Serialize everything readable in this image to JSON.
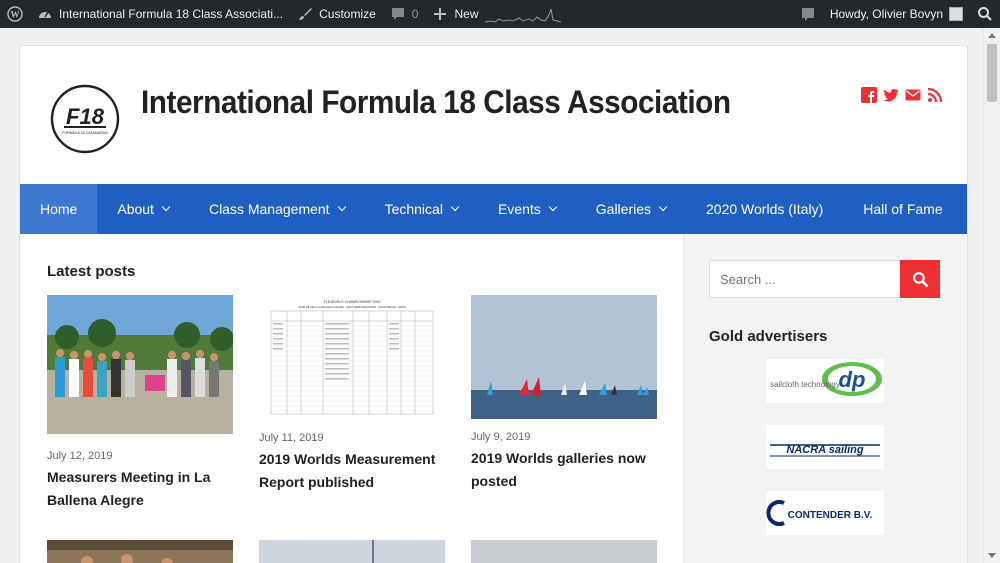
{
  "adminbar": {
    "site_name": "International Formula 18 Class Associati...",
    "customize_label": "Customize",
    "comments_count": "0",
    "new_label": "New",
    "greeting": "Howdy, Olivier Bovyn"
  },
  "site": {
    "title": "International Formula 18 Class Association",
    "logo_text": "F18",
    "logo_subtext": "FORMULA 18 CATAMARAN"
  },
  "social": [
    "facebook-icon",
    "twitter-icon",
    "email-icon",
    "rss-icon"
  ],
  "nav": [
    {
      "label": "Home",
      "active": true,
      "dropdown": false
    },
    {
      "label": "About",
      "dropdown": true
    },
    {
      "label": "Class Management",
      "dropdown": true
    },
    {
      "label": "Technical",
      "dropdown": true
    },
    {
      "label": "Events",
      "dropdown": true
    },
    {
      "label": "Galleries",
      "dropdown": true
    },
    {
      "label": "2020 Worlds (Italy)",
      "dropdown": false
    },
    {
      "label": "Hall of Fame",
      "dropdown": false
    }
  ],
  "main": {
    "section_title": "Latest posts",
    "posts": [
      {
        "date": "July 12, 2019",
        "title": "Measurers Meeting in La Ballena Alegre"
      },
      {
        "date": "July 11, 2019",
        "title": "2019 Worlds Measurement Report published"
      },
      {
        "date": "July 9, 2019",
        "title": "2019 Worlds galleries now posted"
      }
    ],
    "doc_heading": "F18 WORLD CHAMPIONSHIP 2019",
    "doc_subheading": "CLUB DE VELA LA BALLENA ALEGRE - SANT PERE PESCADOR - COSTA BRAVA - SPAIN"
  },
  "sidebar": {
    "search_placeholder": "Search ...",
    "gold_title": "Gold advertisers",
    "advertisers": [
      {
        "name": "sailcloth technology",
        "mark": "dp"
      },
      {
        "name": "NACRA sailing"
      },
      {
        "name": "CONTENDER B.V."
      }
    ]
  },
  "colors": {
    "nav_bg": "#1f5fc2",
    "accent_red": "#ee3035",
    "adminbar_bg": "#23282d"
  }
}
